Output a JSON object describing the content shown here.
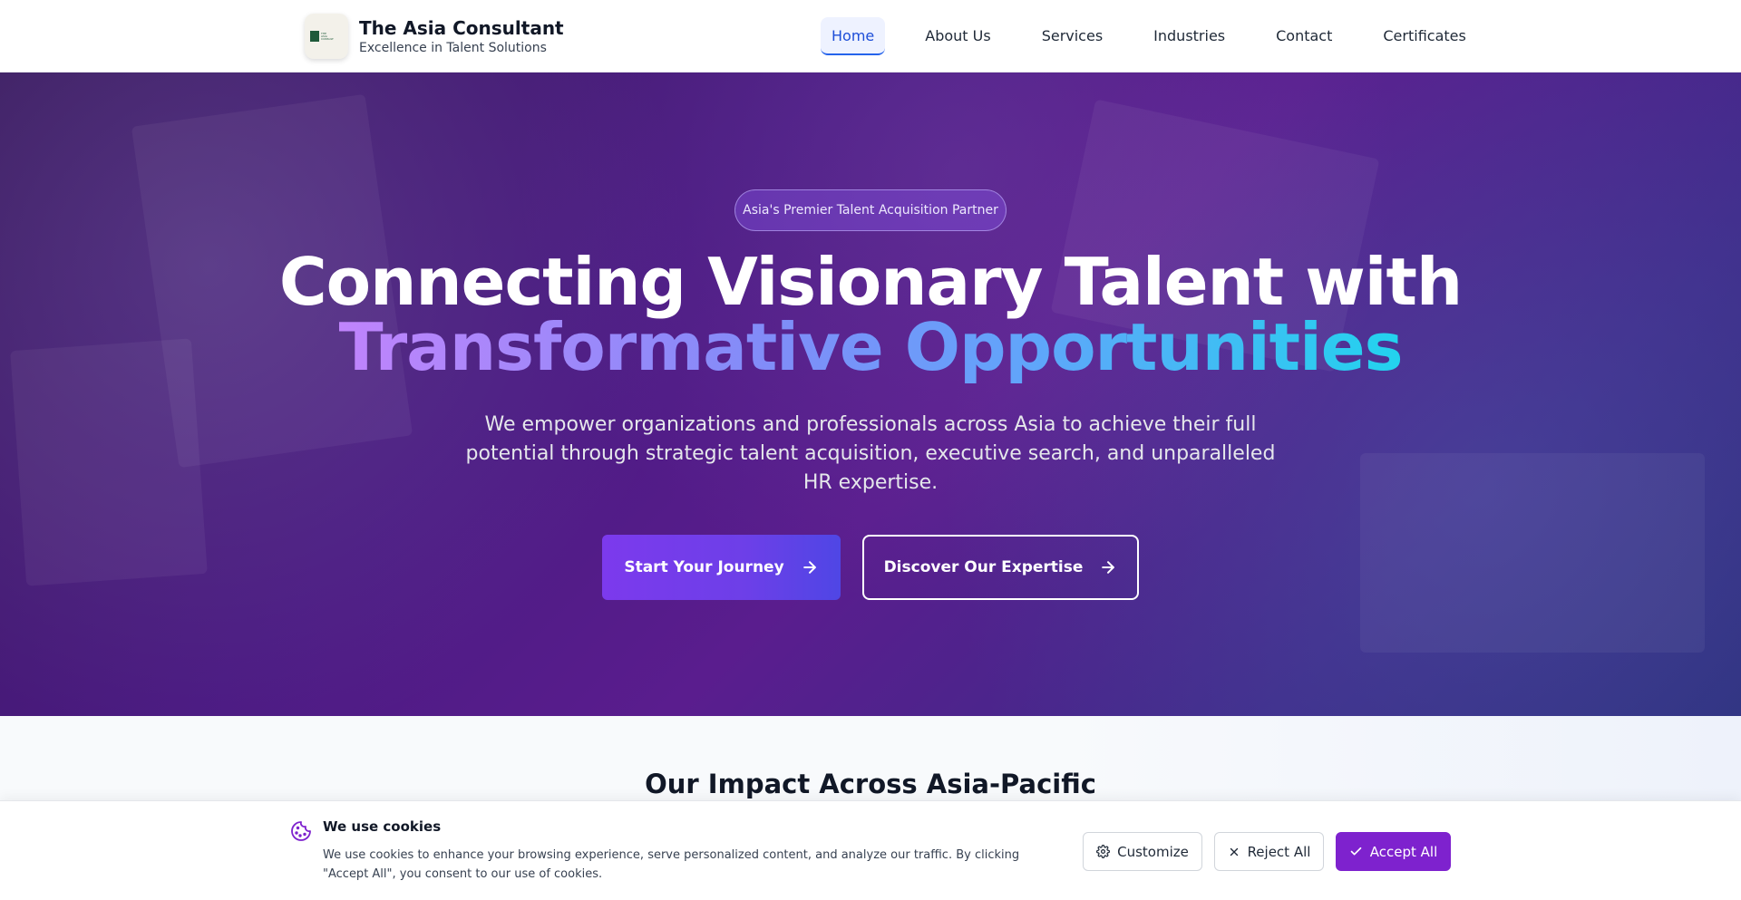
{
  "header": {
    "brand_title": "The Asia Consultant",
    "brand_subtitle": "Excellence in Talent Solutions",
    "nav": [
      {
        "label": "Home",
        "active": true
      },
      {
        "label": "About Us",
        "active": false
      },
      {
        "label": "Services",
        "active": false
      },
      {
        "label": "Industries",
        "active": false
      },
      {
        "label": "Contact",
        "active": false
      },
      {
        "label": "Certificates",
        "active": false
      }
    ]
  },
  "hero": {
    "badge": "Asia's Premier Talent Acquisition Partner",
    "headline_line1": "Connecting Visionary Talent with",
    "headline_line2": "Transformative Opportunities",
    "lead": "We empower organizations and professionals across Asia to achieve their full potential through strategic talent acquisition, executive search, and unparalleled HR expertise.",
    "primary_button": "Start Your Journey",
    "secondary_button": "Discover Our Expertise"
  },
  "impact": {
    "title": "Our Impact Across Asia-Pacific"
  },
  "cookie_banner": {
    "title": "We use cookies",
    "text": "We use cookies to enhance your browsing experience, serve personalized content, and analyze our traffic. By clicking \"Accept All\", you consent to our use of cookies.",
    "customize": "Customize",
    "reject": "Reject All",
    "accept": "Accept All"
  },
  "colors": {
    "accent": "#7e22ce",
    "nav_active": "#1d4ed8",
    "hero_gradient_start": "#c084fc",
    "hero_gradient_end": "#22d3ee"
  },
  "icons": [
    "logo",
    "arrow-right-icon",
    "cookie-icon",
    "gear-icon",
    "close-icon",
    "check-icon"
  ]
}
